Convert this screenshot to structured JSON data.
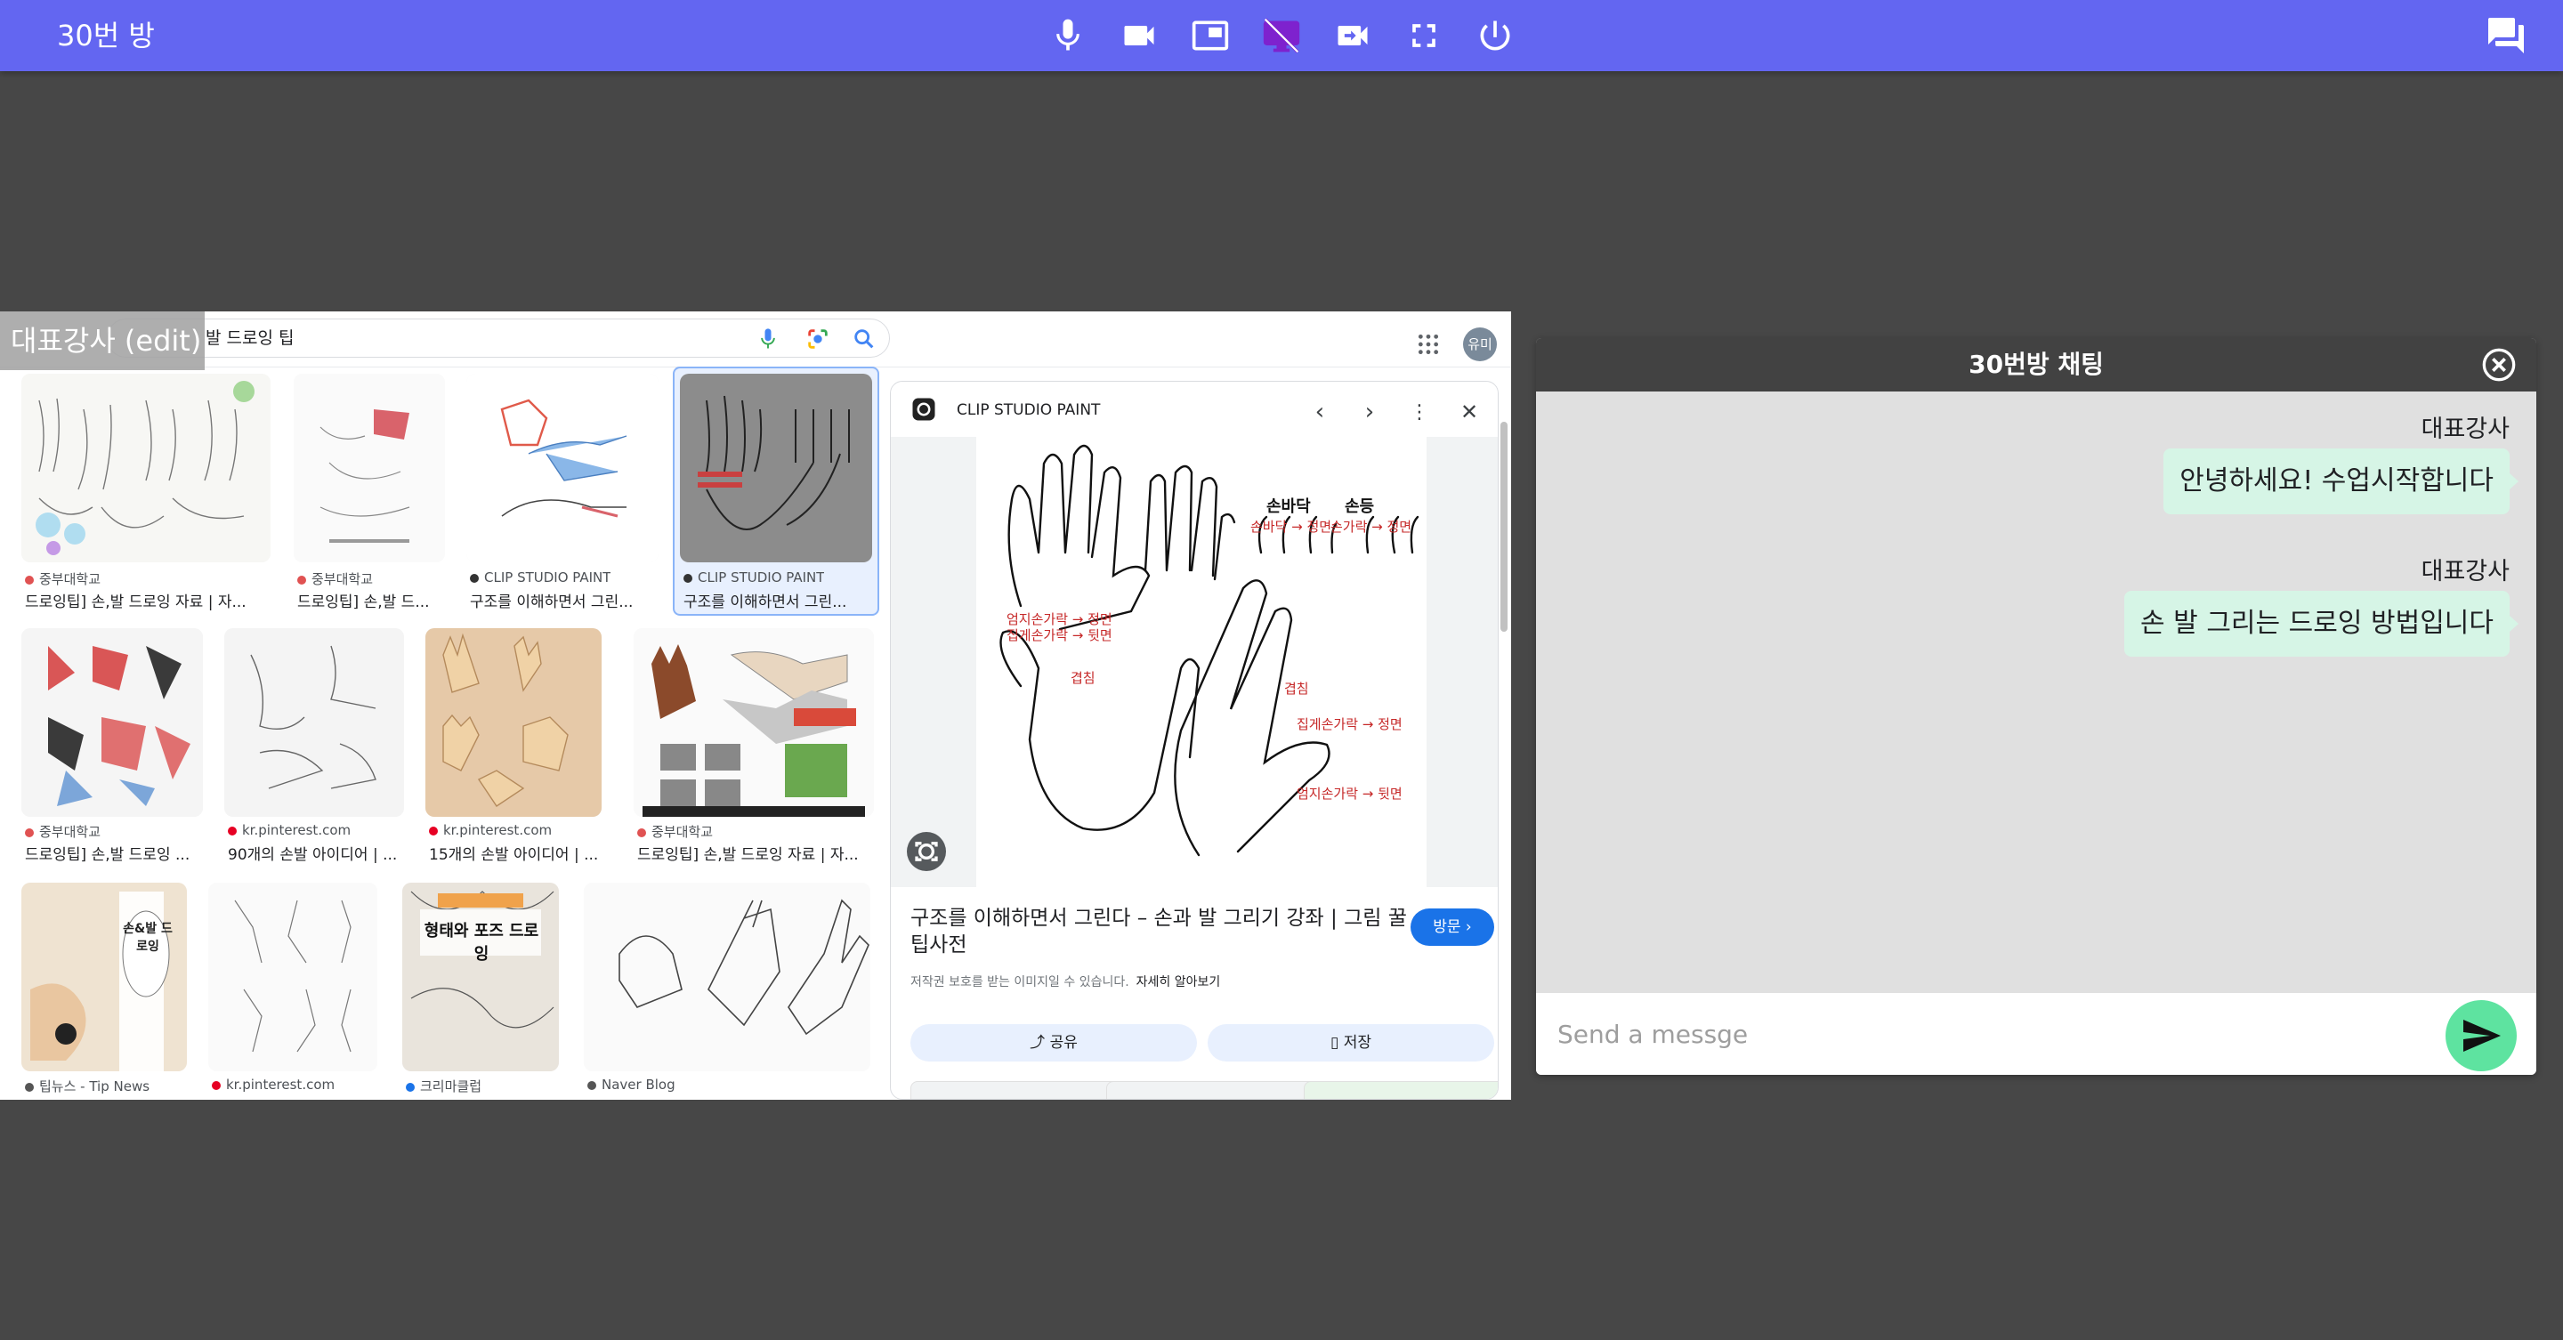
{
  "topbar": {
    "room_title": "30번 방",
    "bg_color": "#6366f1",
    "controls": [
      "mic-icon",
      "video-camera-icon",
      "picture-in-picture-icon",
      "screen-share-off-icon",
      "switch-camera-icon",
      "fullscreen-icon",
      "power-icon"
    ],
    "chat_toggle_icon": "chat-bubbles-icon"
  },
  "shared_screen": {
    "presenter_label": "대표강사 (edit)",
    "search_query": "발 드로잉 팁",
    "profile_initials": "유미",
    "results": [
      {
        "source": "중부대학교",
        "title": "드로잉팁] 손,발 드로잉 자료 | 자..."
      },
      {
        "source": "중부대학교",
        "title": "드로잉팁] 손,발 드..."
      },
      {
        "source": "CLIP STUDIO PAINT",
        "title": "구조를 이해하면서 그린..."
      },
      {
        "source": "CLIP STUDIO PAINT",
        "title": "구조를 이해하면서 그린..."
      },
      {
        "source": "중부대학교",
        "title": "드로잉팁] 손,발 드로잉 ..."
      },
      {
        "source": "kr.pinterest.com",
        "title": "90개의 손발 아이디어 | ..."
      },
      {
        "source": "kr.pinterest.com",
        "title": "15개의 손발 아이디어 | ..."
      },
      {
        "source": "중부대학교",
        "title": "드로잉팁] 손,발 드로잉 자료 | 자..."
      },
      {
        "source": "팁뉴스 - Tip News",
        "title": ""
      },
      {
        "source": "kr.pinterest.com",
        "title": ""
      },
      {
        "source": "크리마클럽",
        "title": ""
      },
      {
        "source": "Naver Blog",
        "title": ""
      }
    ],
    "book_cover_text": "손&발 드로잉",
    "book2_text": "형태와 포즈 드로잉",
    "preview": {
      "site_name": "CLIP STUDIO PAINT",
      "title": "구조를 이해하면서 그린다 – 손과 발 그리기 강좌 | 그림 꿀팁사전",
      "note": "저작권 보호를 받는 이미지일 수 있습니다.",
      "note_link": "자세히 알아보기",
      "visit_label": "방문 ›",
      "share_label": "공유",
      "save_label": "저장",
      "image_labels": {
        "palm": "손바닥",
        "back": "손등",
        "palm_dir": "손바닥 → 정면",
        "finger_dir": "손가락 → 정면",
        "thumb1": "엄지손가락 → 정면",
        "index1": "집게손가락 → 뒷면",
        "overlap1": "겹침",
        "overlap2": "겹침",
        "index2": "집게손가락 → 정면",
        "thumb2": "엄지손가락 → 뒷면"
      }
    }
  },
  "chat": {
    "title": "30번방 채팅",
    "messages": [
      {
        "author": "대표강사",
        "text": "안녕하세요! 수업시작합니다"
      },
      {
        "author": "대표강사",
        "text": "손 발 그리는 드로잉 방법입니다"
      }
    ],
    "input_placeholder": "Send a messge",
    "send_icon": "send-icon",
    "bubble_color": "#d6f5e6",
    "send_color": "#5ee3a0"
  }
}
